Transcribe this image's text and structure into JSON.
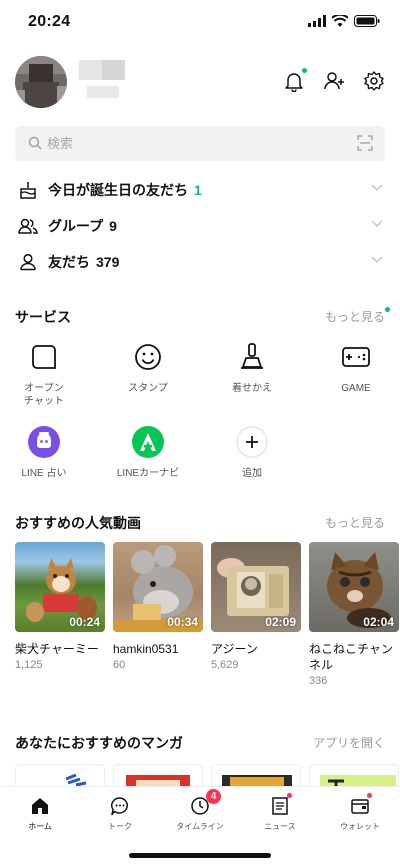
{
  "status_bar": {
    "time": "20:24"
  },
  "search": {
    "placeholder": "検索"
  },
  "friends_list": [
    {
      "label": "今日が誕生日の友だち",
      "count": "1",
      "count_color": "#06c755",
      "icon": "cake-icon"
    },
    {
      "label": "グループ",
      "count": "9",
      "icon": "group-icon"
    },
    {
      "label": "友だち",
      "count": "379",
      "icon": "person-icon"
    }
  ],
  "services": {
    "title": "サービス",
    "more": "もっと見る",
    "items": [
      {
        "label": "オープン\nチャット",
        "icon": "openchat-icon"
      },
      {
        "label": "スタンプ",
        "icon": "smiley-icon"
      },
      {
        "label": "着せかえ",
        "icon": "brush-icon"
      },
      {
        "label": "GAME",
        "icon": "gamepad-icon"
      },
      {
        "label": "LINE 占い",
        "icon": "fortune-icon"
      },
      {
        "label": "LINEカーナビ",
        "icon": "car-navi-icon"
      },
      {
        "label": "追加",
        "icon": "plus-icon"
      }
    ]
  },
  "videos": {
    "title": "おすすめの人気動画",
    "more": "もっと見る",
    "items": [
      {
        "duration": "00:24",
        "title": "柴犬チャーミー",
        "views": "1,125"
      },
      {
        "duration": "00:34",
        "title": "hamkin0531",
        "views": "60"
      },
      {
        "duration": "02:09",
        "title": "アジーン",
        "views": "5,629"
      },
      {
        "duration": "02:04",
        "title": "ねこねこチャンネル",
        "views": "336"
      }
    ]
  },
  "manga": {
    "title": "あなたにおすすめのマンガ",
    "more": "アプリを開く"
  },
  "tabs": [
    {
      "label": "ホーム",
      "icon": "home-icon"
    },
    {
      "label": "トーク",
      "icon": "chat-icon"
    },
    {
      "label": "タイムライン",
      "icon": "clock-icon",
      "badge": "4"
    },
    {
      "label": "ニュース",
      "icon": "news-icon"
    },
    {
      "label": "ウォレット",
      "icon": "wallet-icon"
    }
  ],
  "colors": {
    "accent": "#06c755",
    "badge": "#ff334b"
  }
}
